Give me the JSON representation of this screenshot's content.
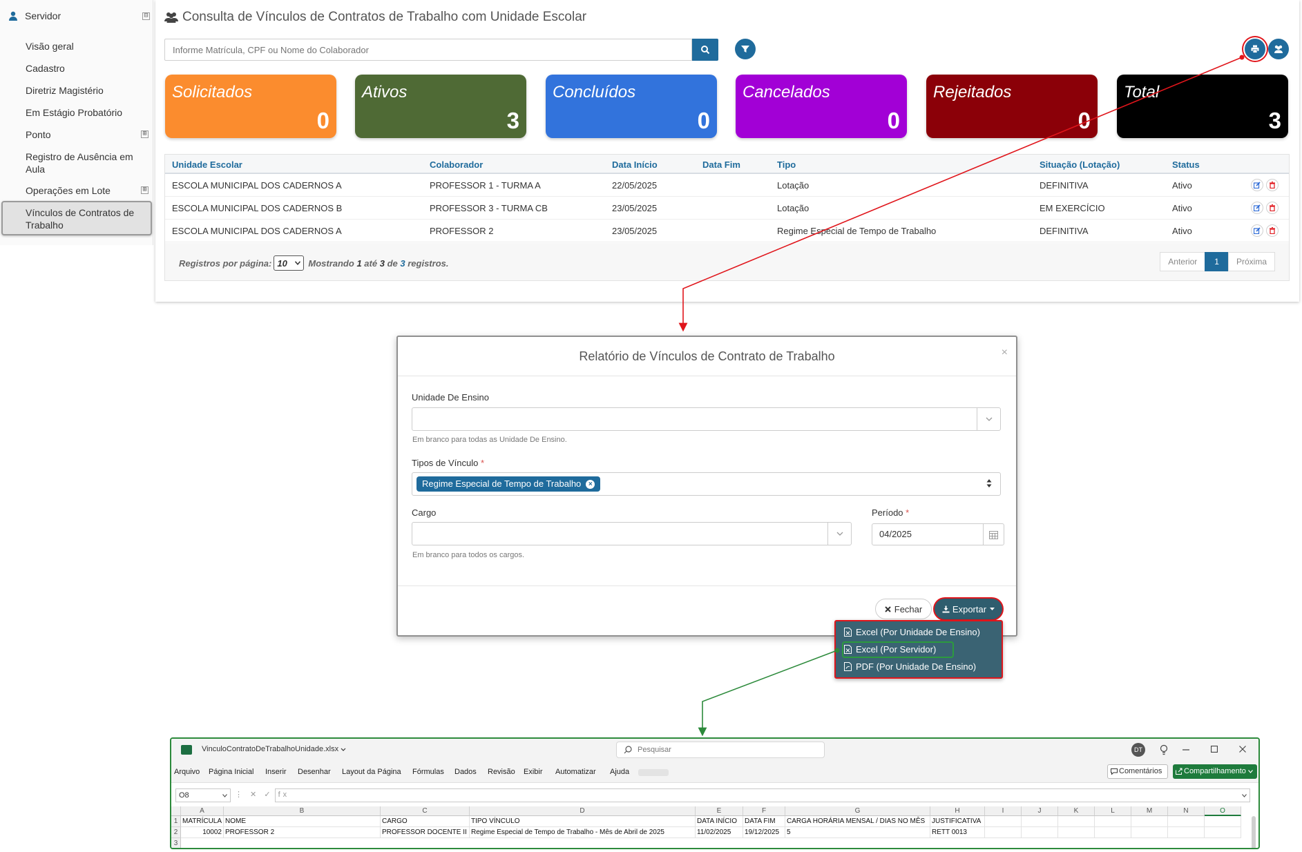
{
  "sidebar": {
    "section_title": "Servidor",
    "toggle_symbol": "⊟",
    "items": [
      {
        "label": "Visão geral"
      },
      {
        "label": "Cadastro"
      },
      {
        "label": "Diretriz Magistério"
      },
      {
        "label": "Em Estágio Probatório"
      },
      {
        "label": "Ponto"
      },
      {
        "label": "Registro de Ausência em Aula"
      },
      {
        "label": "Operações em Lote"
      },
      {
        "label": "Vínculos de Contratos de Trabalho"
      }
    ],
    "expand_symbol": "⊞"
  },
  "header": {
    "title": "Consulta de Vínculos de Contratos de Trabalho com Unidade Escolar",
    "search_placeholder": "Informe Matrícula, CPF ou Nome do Colaborador"
  },
  "cards": [
    {
      "label": "Solicitados",
      "count": "0",
      "color": "#fb8c2e"
    },
    {
      "label": "Ativos",
      "count": "3",
      "color": "#4f6a35"
    },
    {
      "label": "Concluídos",
      "count": "0",
      "color": "#3273dc"
    },
    {
      "label": "Cancelados",
      "count": "0",
      "color": "#a200d6"
    },
    {
      "label": "Rejeitados",
      "count": "0",
      "color": "#8b0008"
    },
    {
      "label": "Total",
      "count": "3",
      "color": "#000000"
    }
  ],
  "table": {
    "headers": [
      "Unidade Escolar",
      "Colaborador",
      "Data Início",
      "Data Fim",
      "Tipo",
      "Situação (Lotação)",
      "Status"
    ],
    "rows": [
      [
        "ESCOLA MUNICIPAL DOS CADERNOS A",
        "PROFESSOR 1 - TURMA A",
        "22/05/2025",
        "",
        "Lotação",
        "DEFINITIVA",
        "Ativo"
      ],
      [
        "ESCOLA MUNICIPAL DOS CADERNOS B",
        "PROFESSOR 3 - TURMA CB",
        "23/05/2025",
        "",
        "Lotação",
        "EM EXERCÍCIO",
        "Ativo"
      ],
      [
        "ESCOLA MUNICIPAL DOS CADERNOS A",
        "PROFESSOR 2",
        "23/05/2025",
        "",
        "Regime Especial de Tempo de Trabalho",
        "DEFINITIVA",
        "Ativo"
      ]
    ],
    "footer": {
      "per_page_label": "Registros por página:",
      "per_page_value": "10",
      "showing": "Mostrando",
      "from": "1",
      "until": "até",
      "to": "3",
      "of": "de",
      "total": "3",
      "records": "registros."
    },
    "pagination": {
      "prev": "Anterior",
      "current": "1",
      "next": "Próxima"
    }
  },
  "modal": {
    "title": "Relatório de Vínculos de Contrato de Trabalho",
    "close": "×",
    "unidade_label": "Unidade De Ensino",
    "unidade_help": "Em branco para todas as Unidade De Ensino.",
    "tipos_label": "Tipos de Vínculo",
    "required_mark": "*",
    "tipos_tag": "Regime Especial de Tempo de Trabalho",
    "tag_remove": "×",
    "cargo_label": "Cargo",
    "cargo_help": "Em branco para todos os cargos.",
    "periodo_label": "Período",
    "periodo_value": "04/2025",
    "fechar": "Fechar",
    "exportar": "Exportar"
  },
  "export_menu": [
    "Excel (Por Unidade De Ensino)",
    "Excel (Por Servidor)",
    "PDF (Por Unidade De Ensino)"
  ],
  "excel": {
    "filename": "VinculoContratoDeTrabalhoUnidade.xlsx",
    "search": "Pesquisar",
    "avatar": "DT",
    "menu": [
      "Arquivo",
      "Página Inicial",
      "Inserir",
      "Desenhar",
      "Layout da Página",
      "Fórmulas",
      "Dados",
      "Revisão",
      "Exibir",
      "Automatizar",
      "Ajuda"
    ],
    "comments": "Comentários",
    "share": "Compartilhamento",
    "namebox": "O8",
    "fx": "fx",
    "columns": [
      "A",
      "B",
      "C",
      "D",
      "E",
      "F",
      "G",
      "H",
      "I",
      "J",
      "K",
      "L",
      "M",
      "N",
      "O"
    ],
    "row_numbers": [
      "1",
      "2",
      "3"
    ],
    "header_row": [
      "MATRÍCULA",
      "NOME",
      "CARGO",
      "TIPO VÍNCULO",
      "DATA INÍCIO",
      "DATA FIM",
      "CARGA HORÁRIA MENSAL / DIAS NO MÊS",
      "JUSTIFICATIVA"
    ],
    "data_row": [
      "10002",
      "PROFESSOR 2",
      "PROFESSOR DOCENTE II",
      "Regime Especial de Tempo de Trabalho - Mês de Abril de 2025",
      "11/02/2025",
      "19/12/2025",
      "5",
      "RETT 0013"
    ]
  },
  "colors": {
    "primary": "#1f6b9c",
    "highlight_red": "#e0151b",
    "highlight_green": "#2c8a3b",
    "export_btn": "#2f5d6e"
  }
}
